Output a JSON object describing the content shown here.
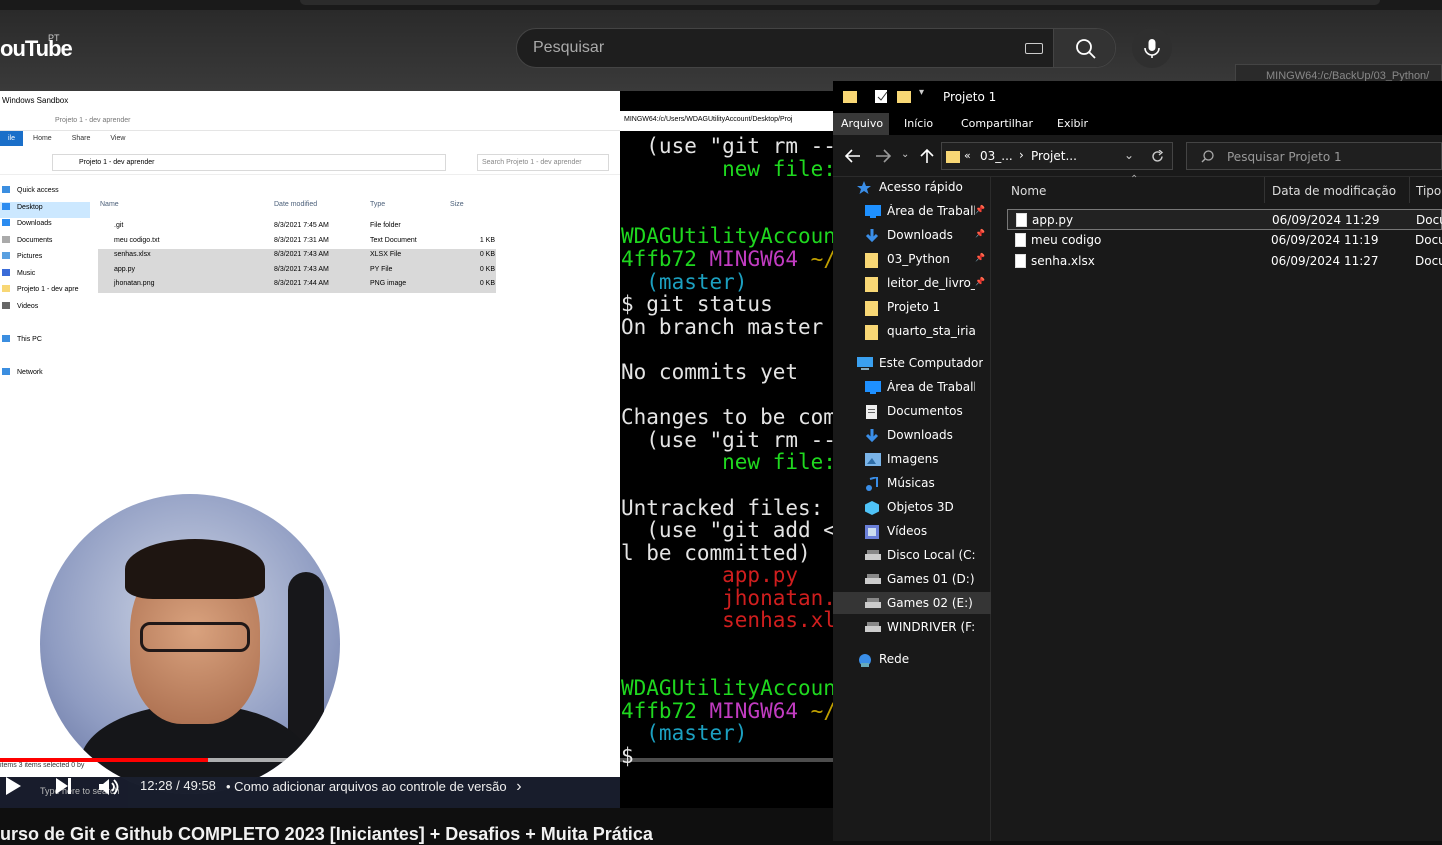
{
  "youtube": {
    "logo": "ouTube",
    "country": "PT",
    "search_placeholder": "Pesquisar",
    "video_title": "urso de Git e Github COMPLETO 2023 [Iniciantes] + Desafios + Muita Prática",
    "player": {
      "time": "12:28 / 49:58",
      "chapter": "• Como adicionar arquivos ao controle de versão",
      "chapter_chevron": "›",
      "progress_fraction": 0.2495
    }
  },
  "video_content": {
    "sandbox_title": "Windows Sandbox",
    "explorer": {
      "title": "Projeto 1 - dev aprender",
      "tabs": [
        "ile",
        "Home",
        "Share",
        "View"
      ],
      "address": "Projeto 1 - dev aprender",
      "search": "Search Projeto 1 - dev aprender",
      "nav": [
        {
          "label": "Quick access"
        },
        {
          "label": "Desktop"
        },
        {
          "label": "Downloads"
        },
        {
          "label": "Documents"
        },
        {
          "label": "Pictures"
        },
        {
          "label": "Music"
        },
        {
          "label": "Projeto 1 - dev apre"
        },
        {
          "label": "Videos"
        },
        {
          "label": ""
        },
        {
          "label": "This PC"
        },
        {
          "label": ""
        },
        {
          "label": "Network"
        }
      ],
      "columns": [
        "Name",
        "Date modified",
        "Type",
        "Size"
      ],
      "rows": [
        {
          "name": ".git",
          "date": "8/3/2021 7:45 AM",
          "type": "File folder",
          "size": ""
        },
        {
          "name": "meu codigo.txt",
          "date": "8/3/2021 7:31 AM",
          "type": "Text Document",
          "size": "1 KB"
        },
        {
          "name": "senhas.xlsx",
          "date": "8/3/2021 7:43 AM",
          "type": "XLSX File",
          "size": "0 KB"
        },
        {
          "name": "app.py",
          "date": "8/3/2021 7:43 AM",
          "type": "PY File",
          "size": "0 KB"
        },
        {
          "name": "jhonatan.png",
          "date": "8/3/2021 7:44 AM",
          "type": "PNG image",
          "size": "0 KB"
        }
      ],
      "status": "items      3 items selected  0 by",
      "taskbar_search": "Type here to search"
    },
    "terminal": {
      "title": "MINGW64:/c/Users/WDAGUtilityAccount/Desktop/Proj",
      "lines": [
        {
          "text": "  (use \"git rm --",
          "c": "tw"
        },
        {
          "text": "        new file:",
          "c": "tg"
        },
        {
          "text": "",
          "c": "tw"
        },
        {
          "text": "",
          "c": "tw"
        },
        {
          "text": "WDAGUtilityAccoun",
          "c": "tg"
        },
        {
          "text": "4ffb72 MINGW64 ~/",
          "c": "mix1"
        },
        {
          "text": "  (master)",
          "c": "tc"
        },
        {
          "text": "$ git status",
          "c": "tw"
        },
        {
          "text": "On branch master",
          "c": "tw"
        },
        {
          "text": "",
          "c": "tw"
        },
        {
          "text": "No commits yet",
          "c": "tw"
        },
        {
          "text": "",
          "c": "tw"
        },
        {
          "text": "Changes to be com",
          "c": "tw"
        },
        {
          "text": "  (use \"git rm --",
          "c": "tw"
        },
        {
          "text": "        new file:",
          "c": "tg"
        },
        {
          "text": "",
          "c": "tw"
        },
        {
          "text": "Untracked files:",
          "c": "tw"
        },
        {
          "text": "  (use \"git add <",
          "c": "tw"
        },
        {
          "text": "l be committed)",
          "c": "tw"
        },
        {
          "text": "        app.py",
          "c": "tr"
        },
        {
          "text": "        jhonatan.",
          "c": "tr"
        },
        {
          "text": "        senhas.xl",
          "c": "tr"
        },
        {
          "text": "",
          "c": "tw"
        },
        {
          "text": "",
          "c": "tw"
        },
        {
          "text": "WDAGUtilityAccoun",
          "c": "tg"
        },
        {
          "text": "4ffb72 MINGW64 ~/",
          "c": "mix2"
        },
        {
          "text": "  (master)",
          "c": "tc"
        },
        {
          "text": "$",
          "c": "tw"
        }
      ]
    }
  },
  "file_explorer": {
    "title": "Projeto 1",
    "ribbon_tabs": [
      "Arquivo",
      "Início",
      "Compartilhar",
      "Exibir"
    ],
    "breadcrumb": [
      "«",
      "03_...",
      "›",
      "Projet..."
    ],
    "search_placeholder": "Pesquisar Projeto 1",
    "background_window_title": "MINGW64:/c/BackUp/03_Python/",
    "nav": [
      {
        "label": "Acesso rápido",
        "indent": 0,
        "icon": "star-icon",
        "pin": false
      },
      {
        "label": "Área de Trabalho",
        "indent": 1,
        "icon": "desktop-icon",
        "pin": true
      },
      {
        "label": "Downloads",
        "indent": 1,
        "icon": "download-icon",
        "pin": true
      },
      {
        "label": "03_Python",
        "indent": 1,
        "icon": "folder-icon",
        "pin": true
      },
      {
        "label": "leitor_de_livro_pı",
        "indent": 1,
        "icon": "folder-icon",
        "pin": true
      },
      {
        "label": "Projeto 1",
        "indent": 1,
        "icon": "folder-icon",
        "pin": false
      },
      {
        "label": "quarto_sta_iria",
        "indent": 1,
        "icon": "folder-icon",
        "pin": false
      },
      {
        "label": "Este Computador",
        "indent": 0,
        "icon": "computer-icon",
        "pin": false
      },
      {
        "label": "Área de Trabalho",
        "indent": 1,
        "icon": "desktop-icon",
        "pin": false
      },
      {
        "label": "Documentos",
        "indent": 1,
        "icon": "documents-icon",
        "pin": false
      },
      {
        "label": "Downloads",
        "indent": 1,
        "icon": "download-icon",
        "pin": false
      },
      {
        "label": "Imagens",
        "indent": 1,
        "icon": "images-icon",
        "pin": false
      },
      {
        "label": "Músicas",
        "indent": 1,
        "icon": "music-icon",
        "pin": false
      },
      {
        "label": "Objetos 3D",
        "indent": 1,
        "icon": "objects-3d-icon",
        "pin": false
      },
      {
        "label": "Vídeos",
        "indent": 1,
        "icon": "videos-icon",
        "pin": false
      },
      {
        "label": "Disco Local (C:)",
        "indent": 1,
        "icon": "drive-icon",
        "pin": false
      },
      {
        "label": "Games 01 (D:)",
        "indent": 1,
        "icon": "drive-icon",
        "pin": false
      },
      {
        "label": "Games 02 (E:)",
        "indent": 1,
        "icon": "drive-icon",
        "pin": false,
        "selected": true
      },
      {
        "label": "WINDRIVER (F:)",
        "indent": 1,
        "icon": "drive-icon",
        "pin": false
      },
      {
        "label": "Rede",
        "indent": 0,
        "icon": "network-icon",
        "pin": false
      }
    ],
    "columns": [
      "Nome",
      "Data de modificação",
      "Tipo"
    ],
    "files": [
      {
        "name": "app.py",
        "date": "06/09/2024 11:29",
        "type": "Docu",
        "selected": true
      },
      {
        "name": "meu codigo",
        "date": "06/09/2024 11:19",
        "type": "Docu"
      },
      {
        "name": "senha.xlsx",
        "date": "06/09/2024 11:27",
        "type": "Docu"
      }
    ]
  }
}
